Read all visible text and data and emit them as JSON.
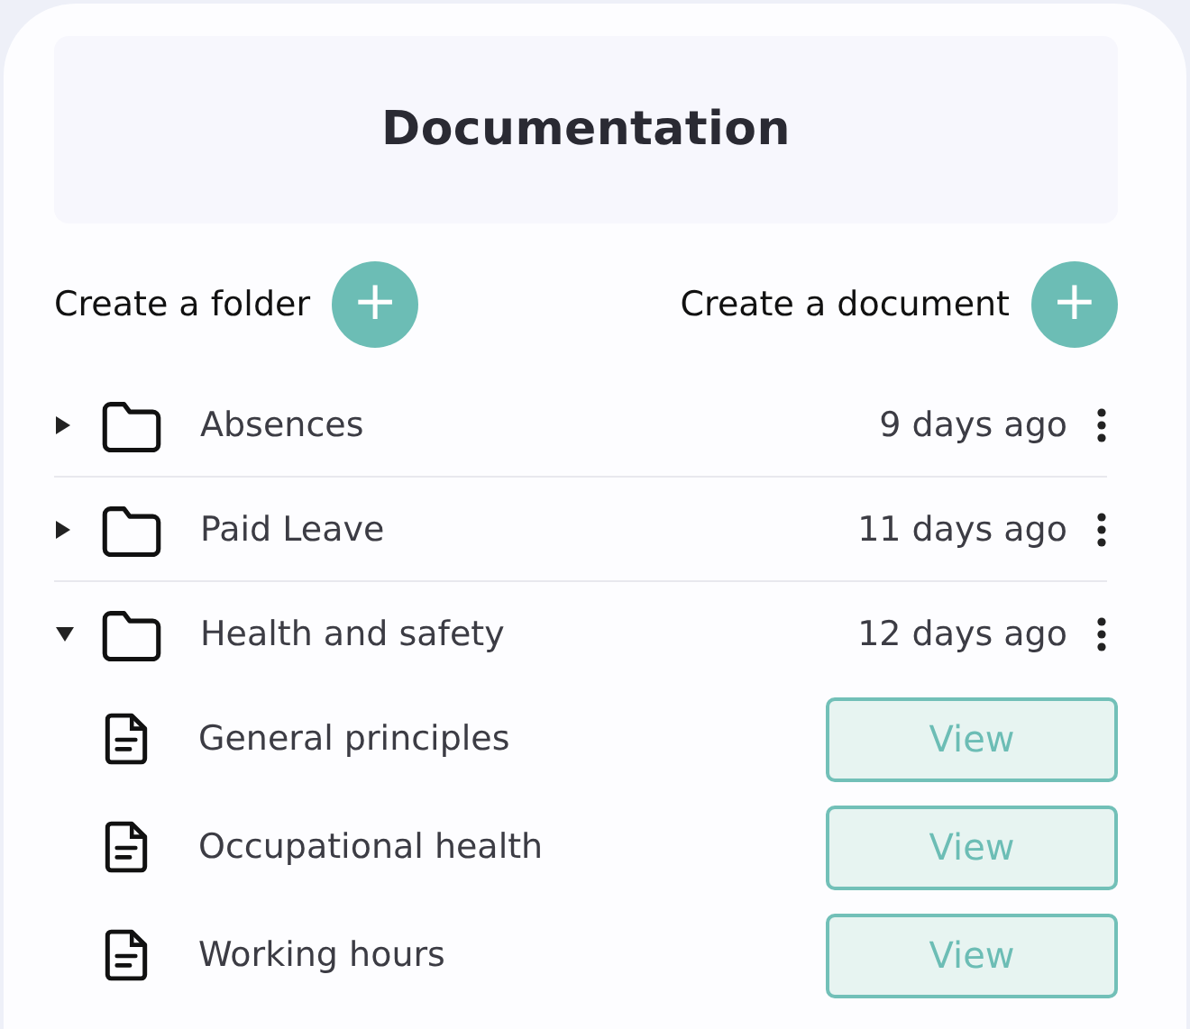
{
  "title": "Documentation",
  "actions": [
    {
      "label": "Create a folder",
      "button": "+"
    },
    {
      "label": "Create a document",
      "button": "+"
    }
  ],
  "folders": [
    {
      "name": "Absences",
      "modified": "9 days ago",
      "expanded": false
    },
    {
      "name": "Paid Leave",
      "modified": "11 days ago",
      "expanded": false
    },
    {
      "name": "Health and safety",
      "modified": "12 days ago",
      "expanded": true,
      "documents": [
        {
          "name": "General principles",
          "action": "View"
        },
        {
          "name": "Occupational health",
          "action": "View"
        },
        {
          "name": "Working hours",
          "action": "View"
        }
      ]
    }
  ]
}
